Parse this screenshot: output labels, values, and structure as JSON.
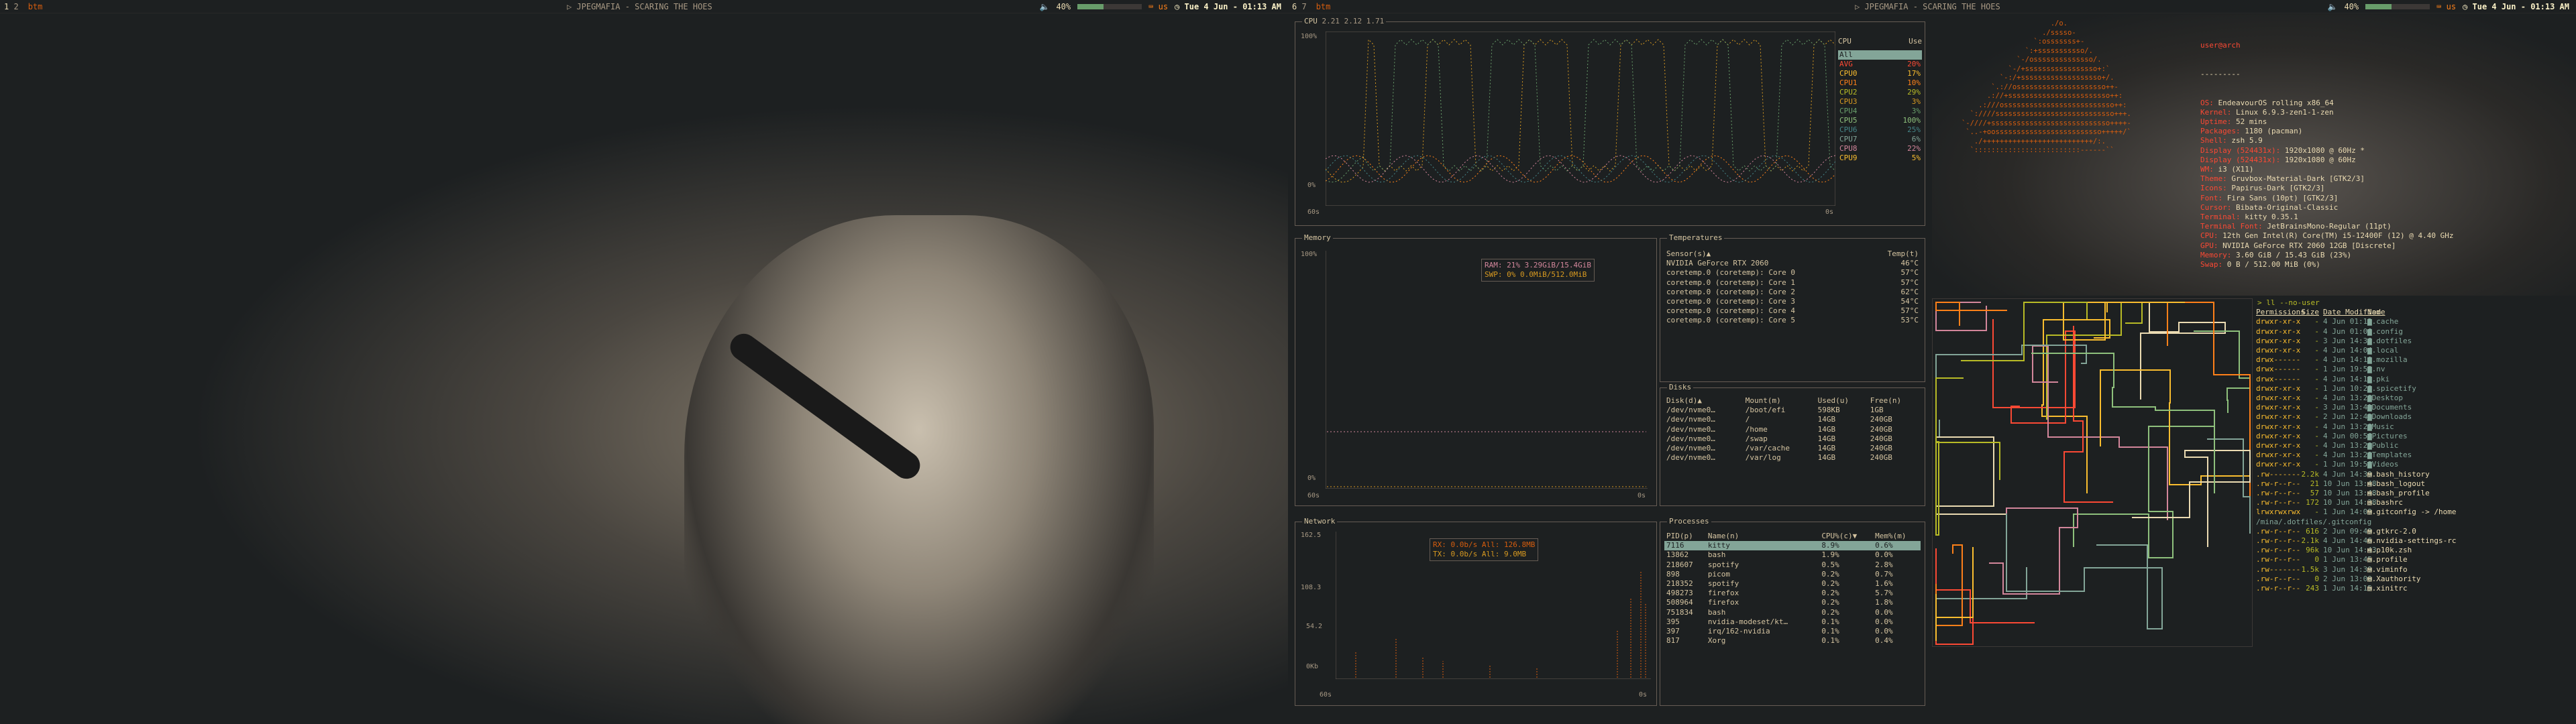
{
  "left_bar": {
    "workspaces": [
      "1",
      "2"
    ],
    "title": "btm",
    "media": "JPEGMAFIA - SCARING THE HOES",
    "volume": "40%",
    "volume_level": 0.4,
    "keyboard": "us",
    "clock": "Tue 4 Jun - 01:13 AM"
  },
  "right_bar": {
    "workspaces": [
      "6",
      "7"
    ],
    "title": "btm",
    "media": "JPEGMAFIA - SCARING THE HOES",
    "volume": "40%",
    "volume_level": 0.4,
    "keyboard": "us",
    "clock": "Tue 4 Jun - 01:13 AM"
  },
  "cpu": {
    "title": "CPU",
    "load": "2.21 2.12 1.71",
    "y_top": "100%",
    "y_bottom": "0%",
    "x_left": "60s",
    "x_right": "0s",
    "legend_header": [
      "CPU",
      "Use"
    ],
    "rows": [
      {
        "name": "All",
        "use": ""
      },
      {
        "name": "AVG",
        "use": "20%"
      },
      {
        "name": "CPU0",
        "use": "17%"
      },
      {
        "name": "CPU1",
        "use": "10%"
      },
      {
        "name": "CPU2",
        "use": "29%"
      },
      {
        "name": "CPU3",
        "use": "3%"
      },
      {
        "name": "CPU4",
        "use": "3%"
      },
      {
        "name": "CPU5",
        "use": "100%"
      },
      {
        "name": "CPU6",
        "use": "25%"
      },
      {
        "name": "CPU7",
        "use": "6%"
      },
      {
        "name": "CPU8",
        "use": "22%"
      },
      {
        "name": "CPU9",
        "use": "5%"
      }
    ]
  },
  "memory": {
    "title": "Memory",
    "y_top": "100%",
    "y_bottom": "0%",
    "x_left": "60s",
    "x_right": "0s",
    "ram": "RAM: 21%   3.29GiB/15.4GiB",
    "swap": "SWP: 0%    0.0MiB/512.0MiB"
  },
  "temps": {
    "title": "Temperatures",
    "header": [
      "Sensor(s)▲",
      "Temp(t)"
    ],
    "rows": [
      [
        "NVIDIA GeForce RTX 2060",
        "46°C"
      ],
      [
        "coretemp.0 (coretemp): Core 0",
        "57°C"
      ],
      [
        "coretemp.0 (coretemp): Core 1",
        "57°C"
      ],
      [
        "coretemp.0 (coretemp): Core 2",
        "62°C"
      ],
      [
        "coretemp.0 (coretemp): Core 3",
        "54°C"
      ],
      [
        "coretemp.0 (coretemp): Core 4",
        "57°C"
      ],
      [
        "coretemp.0 (coretemp): Core 5",
        "53°C"
      ]
    ]
  },
  "disks": {
    "title": "Disks",
    "header": [
      "Disk(d)▲",
      "Mount(m)",
      "Used(u)",
      "Free(n)"
    ],
    "rows": [
      [
        "/dev/nvme0…",
        "/boot/efi",
        "598KB",
        "1GB"
      ],
      [
        "/dev/nvme0…",
        "/",
        "14GB",
        "240GB"
      ],
      [
        "/dev/nvme0…",
        "/home",
        "14GB",
        "240GB"
      ],
      [
        "/dev/nvme0…",
        "/swap",
        "14GB",
        "240GB"
      ],
      [
        "/dev/nvme0…",
        "/var/cache",
        "14GB",
        "240GB"
      ],
      [
        "/dev/nvme0…",
        "/var/log",
        "14GB",
        "240GB"
      ]
    ]
  },
  "network": {
    "title": "Network",
    "y_ticks": [
      "162.5",
      "108.3",
      "54.2",
      "0Kb"
    ],
    "x_left": "60s",
    "x_right": "0s",
    "rx": "RX: 0.0b/s    All: 126.8MB",
    "tx": "TX: 0.0b/s    All: 9.0MB"
  },
  "processes": {
    "title": "Processes",
    "header": [
      "PID(p)",
      "Name(n)",
      "CPU%(c)▼",
      "Mem%(m)"
    ],
    "rows": [
      [
        "7116",
        "kitty",
        "8.9%",
        "0.6%"
      ],
      [
        "13862",
        "bash",
        "1.9%",
        "0.0%"
      ],
      [
        "218607",
        "spotify",
        "0.5%",
        "2.8%"
      ],
      [
        "898",
        "picom",
        "0.2%",
        "0.7%"
      ],
      [
        "218352",
        "spotify",
        "0.2%",
        "1.6%"
      ],
      [
        "498273",
        "firefox",
        "0.2%",
        "5.7%"
      ],
      [
        "508964",
        "firefox",
        "0.2%",
        "1.8%"
      ],
      [
        "751834",
        "bash",
        "0.2%",
        "0.0%"
      ],
      [
        "395",
        "nvidia-modeset/kt…",
        "0.1%",
        "0.0%"
      ],
      [
        "397",
        "irq/162-nvidia",
        "0.1%",
        "0.0%"
      ],
      [
        "817",
        "Xorg",
        "0.1%",
        "0.4%"
      ]
    ]
  },
  "neofetch": {
    "user": "user@arch",
    "separator": "---------",
    "lines": [
      [
        "OS: ",
        "EndeavourOS rolling x86_64"
      ],
      [
        "Kernel: ",
        "Linux 6.9.3-zen1-1-zen"
      ],
      [
        "Uptime: ",
        "52 mins"
      ],
      [
        "Packages: ",
        "1180 (pacman)"
      ],
      [
        "Shell: ",
        "zsh 5.9"
      ],
      [
        "Display (524431x): ",
        "1920x1080 @ 60Hz *"
      ],
      [
        "Display (524431x): ",
        "1920x1080 @ 60Hz"
      ],
      [
        "WM: ",
        "i3 (X11)"
      ],
      [
        "Theme: ",
        "Gruvbox-Material-Dark [GTK2/3]"
      ],
      [
        "Icons: ",
        "Papirus-Dark [GTK2/3]"
      ],
      [
        "Font: ",
        "Fira Sans (10pt) [GTK2/3]"
      ],
      [
        "Cursor: ",
        "Bibata-Original-Classic"
      ],
      [
        "Terminal: ",
        "kitty 0.35.1"
      ],
      [
        "Terminal Font: ",
        "JetBrainsMono-Regular (11pt)"
      ],
      [
        "CPU: ",
        "12th Gen Intel(R) Core(TM) i5-12400F (12) @ 4.40 GHz"
      ],
      [
        "GPU: ",
        "NVIDIA GeForce RTX 2060 12GB [Discrete]"
      ],
      [
        "Memory: ",
        "3.60 GiB / 15.43 GiB (23%)"
      ],
      [
        "Swap: ",
        "0 B / 512.00 MiB (0%)"
      ]
    ]
  },
  "ls": {
    "prompt": "> ll --no-user",
    "header": [
      "Permissions",
      "Size",
      "Date Modified",
      "Name"
    ],
    "rows": [
      [
        "drwxr-xr-x",
        "-",
        "4 Jun 01:13",
        ".cache",
        "d"
      ],
      [
        "drwxr-xr-x",
        "-",
        "4 Jun 01:06",
        ".config",
        "d"
      ],
      [
        "drwxr-xr-x",
        "-",
        "3 Jun 14:36",
        ".dotfiles",
        "d"
      ],
      [
        "drwxr-xr-x",
        "-",
        "4 Jun 14:04",
        ".local",
        "d"
      ],
      [
        "drwx------",
        "-",
        "4 Jun 14:10",
        ".mozilla",
        "d"
      ],
      [
        "drwx------",
        "-",
        "1 Jun 19:55",
        ".nv",
        "d"
      ],
      [
        "drwx------",
        "-",
        "4 Jun 14:15",
        ".pki",
        "d"
      ],
      [
        "drwxr-xr-x",
        "-",
        "1 Jun 10:28",
        ".spicetify",
        "d"
      ],
      [
        "drwxr-xr-x",
        "-",
        "4 Jun 13:28",
        "Desktop",
        "d"
      ],
      [
        "drwxr-xr-x",
        "-",
        "3 Jun 13:41",
        "Documents",
        "d"
      ],
      [
        "drwxr-xr-x",
        "-",
        "2 Jun 12:43",
        "Downloads",
        "d"
      ],
      [
        "drwxr-xr-x",
        "-",
        "4 Jun 13:28",
        "Music",
        "d"
      ],
      [
        "drwxr-xr-x",
        "-",
        "4 Jun 00:56",
        "Pictures",
        "d"
      ],
      [
        "drwxr-xr-x",
        "-",
        "4 Jun 13:28",
        "Public",
        "d"
      ],
      [
        "drwxr-xr-x",
        "-",
        "4 Jun 13:28",
        "Templates",
        "d"
      ],
      [
        "drwxr-xr-x",
        "-",
        "1 Jun 19:58",
        "Videos",
        "d"
      ],
      [
        ".rw-------",
        "2.2k",
        "4 Jun 14:39",
        ".bash_history",
        "f"
      ],
      [
        ".rw-r--r--",
        "21",
        "10 Jun 13:48",
        ".bash_logout",
        "f"
      ],
      [
        ".rw-r--r--",
        "57",
        "10 Jun 13:48",
        ".bash_profile",
        "f"
      ],
      [
        ".rw-r--r--",
        "172",
        "10 Jun 14:38",
        ".bashrc",
        "f"
      ],
      [
        "lrwxrwxrwx",
        "-",
        "1 Jun 14:09",
        ".gitconfig -> /home",
        "l"
      ],
      [
        "/mina/.dotfiles/.gitconfig",
        "",
        "",
        "",
        "c"
      ],
      [
        ".rw-r--r--",
        "616",
        "2 Jun 09:49",
        ".gtkrc-2.0",
        "f"
      ],
      [
        ".rw-r--r--",
        "2.1k",
        "4 Jun 14:46",
        ".nvidia-settings-rc",
        "f"
      ],
      [
        ".rw-r--r--",
        "96k",
        "10 Jun 14:43",
        ".p10k.zsh",
        "f"
      ],
      [
        ".rw-r--r--",
        "0",
        "1 Jun 13:45",
        ".profile",
        "f"
      ],
      [
        ".rw-------",
        "1.5k",
        "3 Jun 14:39",
        ".viminfo",
        "f"
      ],
      [
        ".rw-r--r--",
        "0",
        "2 Jun 13:00",
        ".Xauthority",
        "f"
      ],
      [
        ".rw-r--r--",
        "243",
        "1 Jun 14:15",
        ".xinitrc",
        "f"
      ]
    ]
  },
  "colors": {
    "bg": "#1d2021",
    "fg": "#ebdbb2",
    "accent": "#83a598",
    "orange": "#d65d0e",
    "yellow": "#d79921",
    "red": "#fb4934"
  }
}
